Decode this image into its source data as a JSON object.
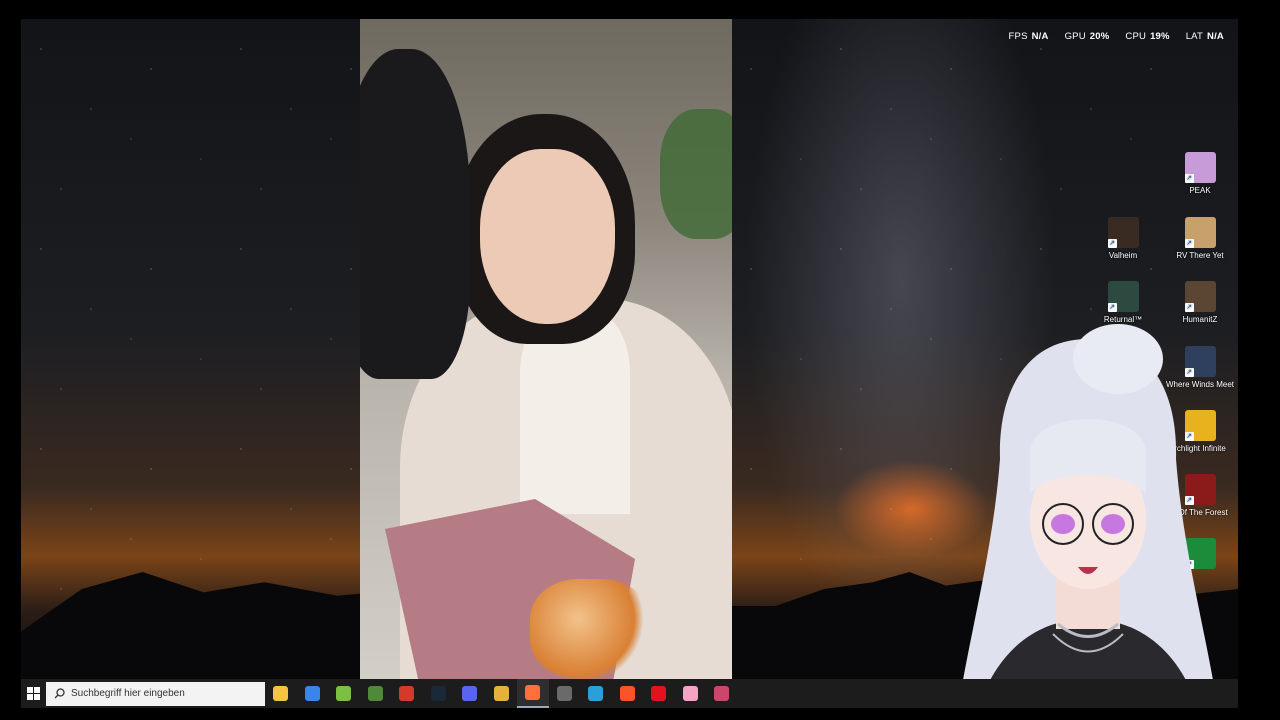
{
  "overlay_stats": [
    {
      "label": "FPS",
      "value": "N/A"
    },
    {
      "label": "GPU",
      "value": "20%"
    },
    {
      "label": "CPU",
      "value": "19%"
    },
    {
      "label": "LAT",
      "value": "N/A"
    }
  ],
  "desktop_icons": [
    {
      "label": "PEAK",
      "color": "#c79ad8",
      "icon": "peak-icon"
    },
    {
      "label": "Valheim",
      "color": "#3a2b22",
      "icon": "valheim-icon"
    },
    {
      "label": "RV There Yet",
      "color": "#c7a06c",
      "icon": "rv-there-yet-icon"
    },
    {
      "label": "Returnal™",
      "color": "#2c4a40",
      "icon": "returnal-icon"
    },
    {
      "label": "HumanitZ",
      "color": "#5a4632",
      "icon": "humanitz-icon"
    },
    {
      "label": "Where Winds Meet",
      "color": "#2f3f5e",
      "icon": "where-winds-meet-icon"
    },
    {
      "label": "rchlight Infinite",
      "color": "#e8b21e",
      "icon": "torchlight-infinite-icon"
    },
    {
      "label": "s Of The Forest",
      "color": "#8b1a1a",
      "icon": "sons-of-the-forest-icon"
    },
    {
      "label": "...",
      "color": "#1d8c3a",
      "icon": "game-icon"
    }
  ],
  "taskbar": {
    "search_placeholder": "Suchbegriff hier eingeben",
    "apps": [
      {
        "name": "file-explorer-icon",
        "color": "#f5c542",
        "active": false
      },
      {
        "name": "microsoft-store-icon",
        "color": "#3a86e8",
        "active": false
      },
      {
        "name": "android-app-icon",
        "color": "#7bc043",
        "active": false
      },
      {
        "name": "minecraft-icon",
        "color": "#4f8a3b",
        "active": false
      },
      {
        "name": "news-app-icon",
        "color": "#d33a2c",
        "active": false
      },
      {
        "name": "steam-icon",
        "color": "#1b2838",
        "active": false
      },
      {
        "name": "discord-icon",
        "color": "#5865f2",
        "active": false
      },
      {
        "name": "chrome-icon",
        "color": "#e2b33a",
        "active": false
      },
      {
        "name": "firefox-icon",
        "color": "#ff7139",
        "active": true
      },
      {
        "name": "obs-icon",
        "color": "#6a6a6a",
        "active": false
      },
      {
        "name": "app-blue-icon",
        "color": "#2ba0d8",
        "active": false
      },
      {
        "name": "brave-icon",
        "color": "#fb542b",
        "active": false
      },
      {
        "name": "opera-icon",
        "color": "#e0131e",
        "active": false
      },
      {
        "name": "heart-app-icon",
        "color": "#f3a5c3",
        "active": false
      },
      {
        "name": "pink-app-icon",
        "color": "#c8476b",
        "active": false
      }
    ]
  }
}
